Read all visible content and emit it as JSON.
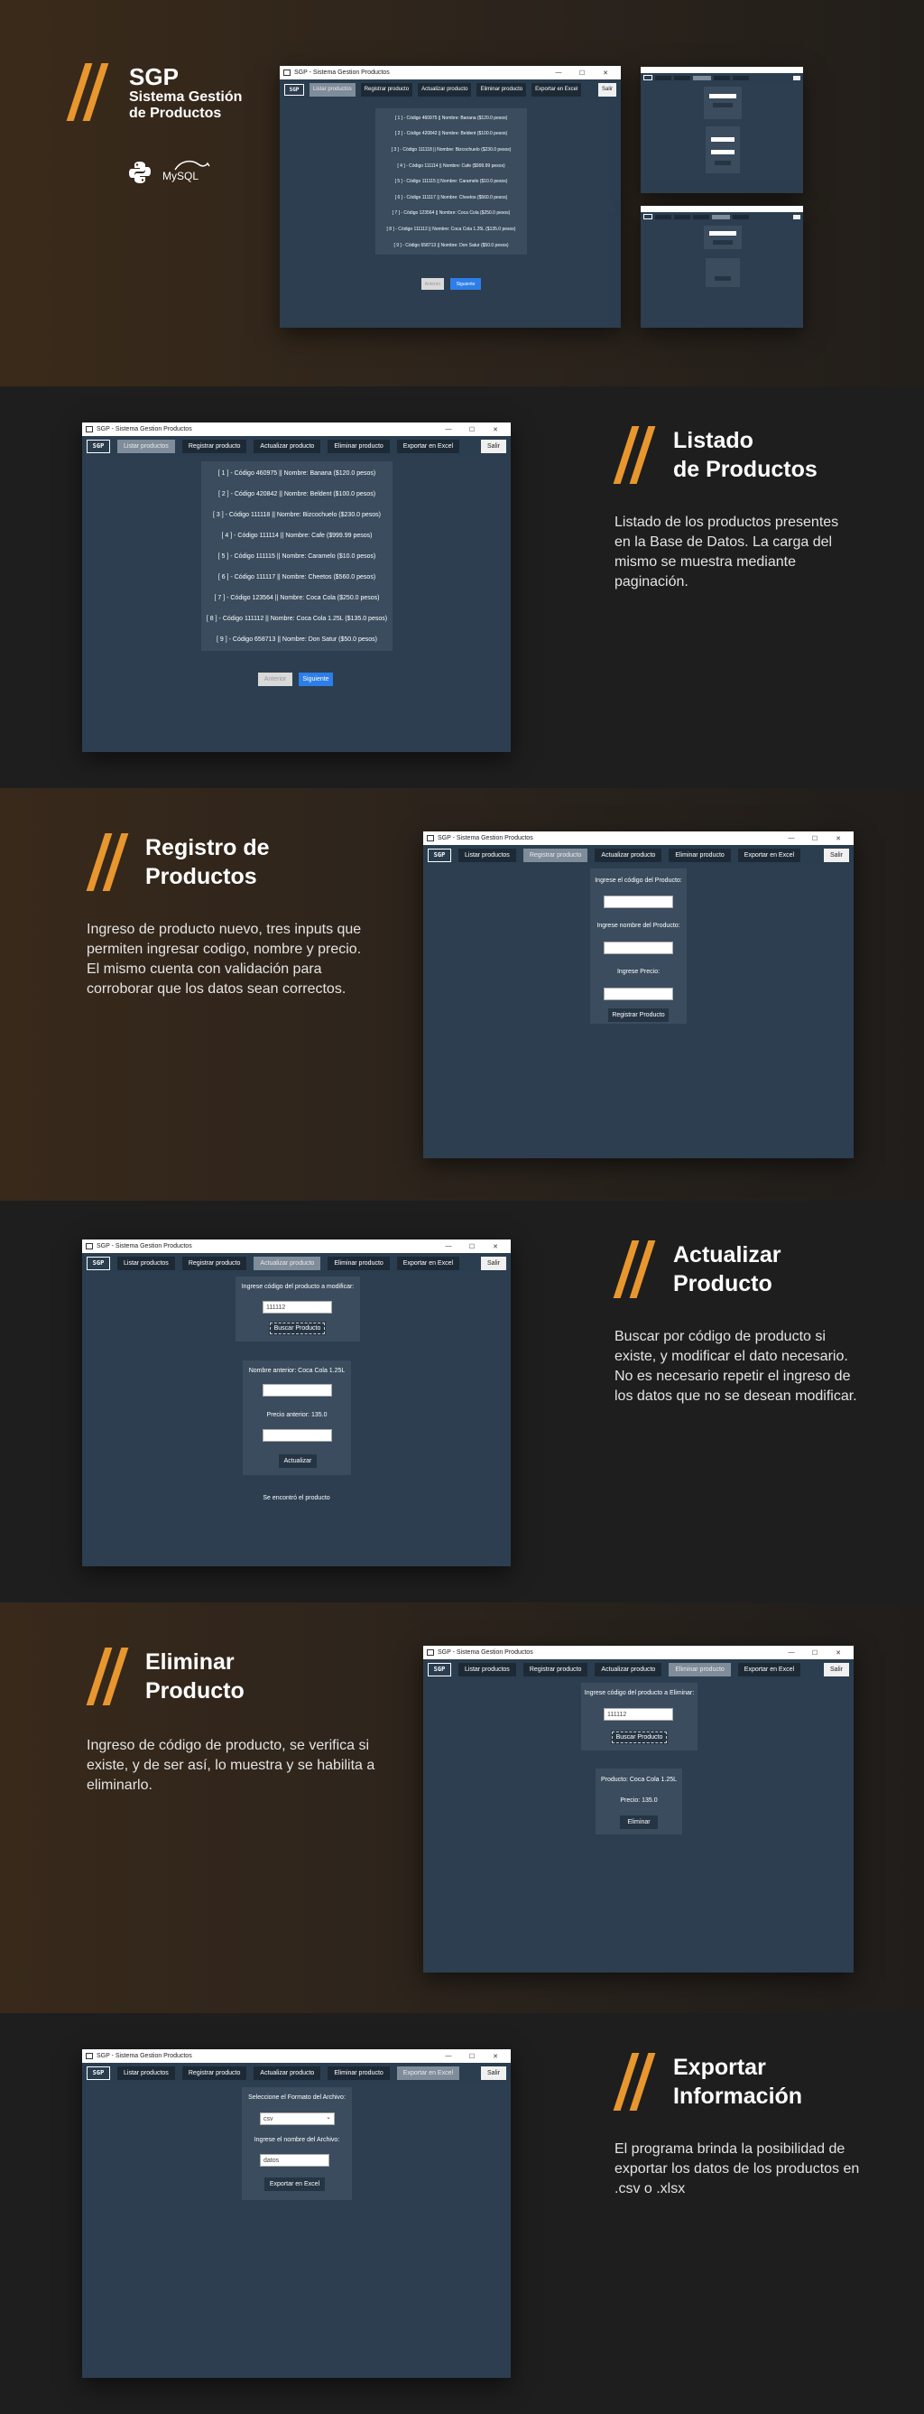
{
  "hero": {
    "brand": "SGP",
    "subtitle_line1": "Sistema Gestión",
    "subtitle_line2": "de Productos",
    "mysql": "MySQL"
  },
  "window": {
    "title": "SGP - Sistema Gestion Productos",
    "minimize": "—",
    "maximize": "☐",
    "close": "✕",
    "logo": "SGP",
    "tabs": [
      "Listar productos",
      "Registrar producto",
      "Actualizar producto",
      "Eliminar producto",
      "Exportar en Excel"
    ],
    "exit": "Salir"
  },
  "products": [
    "[ 1 ] - Código 460975  ||  Nombre: Banana ($120.0 pesos)",
    "[ 2 ] - Código 420842  ||  Nombre: Beldent ($100.0 pesos)",
    "[ 3 ] - Código 111118  ||  Nombre: Bizcochuelo ($230.0 pesos)",
    "[ 4 ] - Código 111114  ||  Nombre: Cafe ($999.99 pesos)",
    "[ 5 ] - Código 111115  ||  Nombre: Caramelo ($10.0 pesos)",
    "[ 6 ] - Código 111117  ||  Nombre: Cheetos ($560.0 pesos)",
    "[ 7 ] - Código 123564  ||  Nombre: Coca Cola ($250.0 pesos)",
    "[ 8 ] - Código 111112  ||  Nombre: Coca Cola 1.25L ($135.0 pesos)",
    "[ 9 ] - Código 658713  ||  Nombre: Don Satur ($50.0 pesos)"
  ],
  "pagination": {
    "prev": "Anterior",
    "next": "Siguiente"
  },
  "listado": {
    "title_line1": "Listado",
    "title_line2": "de Productos",
    "desc": "Listado de los productos presentes en la Base de Datos. La carga del mismo se muestra mediante paginación."
  },
  "registro": {
    "title_line1": "Registro de",
    "title_line2": "Productos",
    "desc": "Ingreso de producto nuevo, tres inputs que permiten ingresar codigo, nombre y precio. El mismo cuenta con validación para corroborar que los datos sean correctos.",
    "label_code": "Ingrese el código del Producto:",
    "label_name": "Ingrese nombre del Producto:",
    "label_price": "Ingrese Precio:",
    "button": "Registrar Producto"
  },
  "actualizar": {
    "title_line1": "Actualizar",
    "title_line2": "Producto",
    "desc": "Buscar por código de producto si existe, y modificar el dato necesario. No es necesario repetir el ingreso de los datos que no se desean modificar.",
    "label_search": "Ingrese código del producto a modificar:",
    "search_value": "111112",
    "search_button": "Buscar Producto",
    "prev_name": "Nombre anterior: Coca Cola 1.25L",
    "prev_price": "Precio anterior: 135.0",
    "update_button": "Actualizar",
    "status": "Se encontró el producto"
  },
  "eliminar": {
    "title_line1": "Eliminar",
    "title_line2": "Producto",
    "desc": "Ingreso de código de producto, se verifica si existe, y de ser así, lo muestra y se habilita a eliminarlo.",
    "label_search": "Ingrese código del producto a Eliminar:",
    "search_value": "111112",
    "search_button": "Buscar Producto",
    "product": "Producto: Coca Cola 1.25L",
    "price": "Precio: 135.0",
    "delete_button": "Eliminar"
  },
  "exportar": {
    "title_line1": "Exportar",
    "title_line2": "Información",
    "desc": "El programa brinda la posibilidad de exportar los datos de los productos en .csv o .xlsx",
    "label_format": "Seleccione el Formato del Archivo:",
    "format_value": "csv",
    "label_name": "Ingrese el nombre del Archivo:",
    "name_value": "datos",
    "button": "Exportar en Excel"
  }
}
